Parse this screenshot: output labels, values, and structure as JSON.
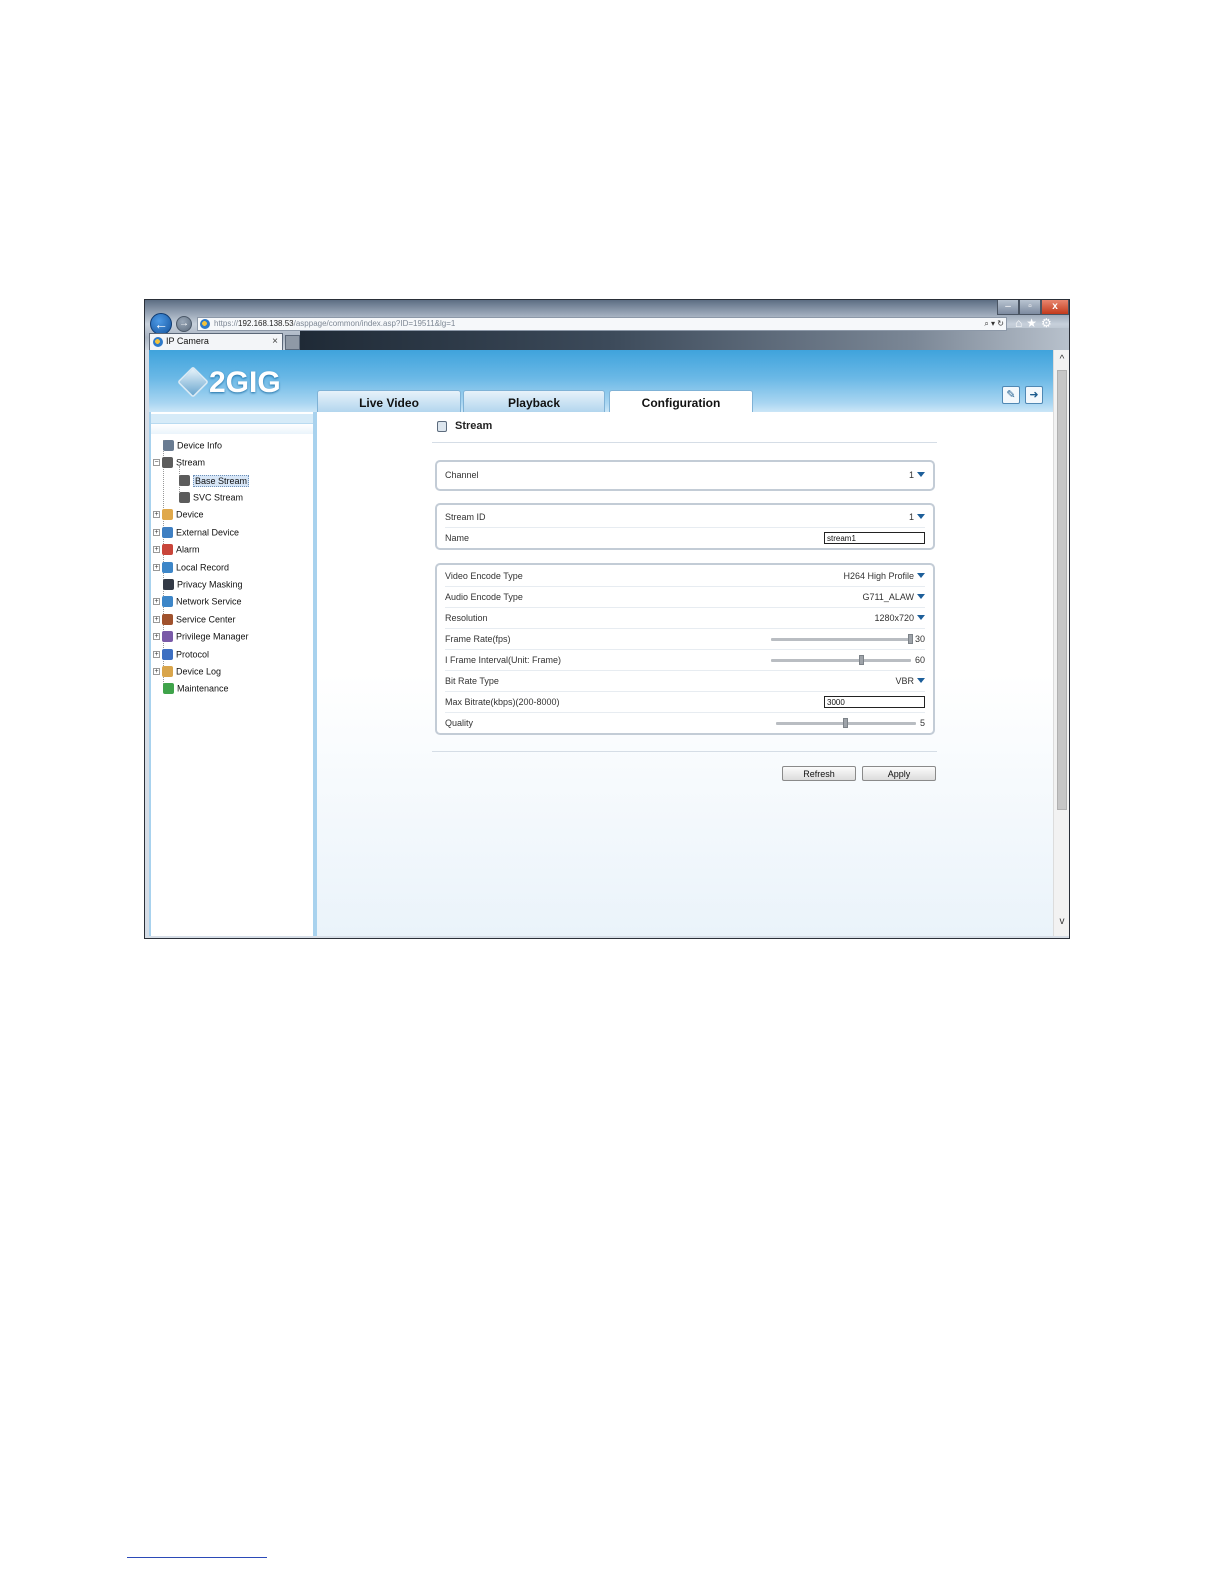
{
  "browser": {
    "window_controls": {
      "minimize": "–",
      "maximize": "▫",
      "close": "x"
    },
    "back": "←",
    "forward": "→",
    "address": {
      "scheme": "https://",
      "host": "192.168.138.53",
      "path": "/asppage/common/index.asp?ID=19511&lg=1",
      "tools": "⌕ ▾ ↻"
    },
    "nav_icons": "⌂★⚙",
    "tab": {
      "title": "IP Camera",
      "close": "×"
    }
  },
  "header": {
    "logo_text": "2GIG",
    "tabs": [
      {
        "label": "Live Video"
      },
      {
        "label": "Playback"
      },
      {
        "label": "Configuration"
      }
    ],
    "active_tab": "Configuration",
    "edit_icon": "✎",
    "logout_icon": "➜"
  },
  "sidebar": {
    "items": [
      {
        "label": "Device Info",
        "icon": "device-info-icon",
        "expander": ""
      },
      {
        "label": "Stream",
        "icon": "stream-icon",
        "expander": "−"
      },
      {
        "label": "Base Stream",
        "icon": "base-stream-icon",
        "expander": "",
        "selected": true
      },
      {
        "label": "SVC Stream",
        "icon": "svc-stream-icon",
        "expander": ""
      },
      {
        "label": "Device",
        "icon": "device-icon",
        "expander": "+"
      },
      {
        "label": "External Device",
        "icon": "external-device-icon",
        "expander": "+"
      },
      {
        "label": "Alarm",
        "icon": "alarm-icon",
        "expander": "+"
      },
      {
        "label": "Local Record",
        "icon": "local-record-icon",
        "expander": "+"
      },
      {
        "label": "Privacy Masking",
        "icon": "privacy-masking-icon",
        "expander": ""
      },
      {
        "label": "Network Service",
        "icon": "network-service-icon",
        "expander": "+"
      },
      {
        "label": "Service Center",
        "icon": "service-center-icon",
        "expander": "+"
      },
      {
        "label": "Privilege Manager",
        "icon": "privilege-manager-icon",
        "expander": "+"
      },
      {
        "label": "Protocol",
        "icon": "protocol-icon",
        "expander": "+"
      },
      {
        "label": "Device Log",
        "icon": "device-log-icon",
        "expander": "+"
      },
      {
        "label": "Maintenance",
        "icon": "maintenance-icon",
        "expander": ""
      }
    ]
  },
  "content": {
    "title": "Stream",
    "channel": {
      "label": "Channel",
      "value": "1"
    },
    "stream_id": {
      "label": "Stream ID",
      "value": "1"
    },
    "name": {
      "label": "Name",
      "value": "stream1"
    },
    "video_encode_type": {
      "label": "Video Encode Type",
      "value": "H264 High Profile"
    },
    "audio_encode_type": {
      "label": "Audio Encode Type",
      "value": "G711_ALAW"
    },
    "resolution": {
      "label": "Resolution",
      "value": "1280x720"
    },
    "frame_rate": {
      "label": "Frame Rate(fps)",
      "value": "30",
      "level": 1.0
    },
    "i_frame_interval": {
      "label": "I Frame Interval(Unit: Frame)",
      "value": "60",
      "level": 0.65
    },
    "bit_rate_type": {
      "label": "Bit Rate Type",
      "value": "VBR"
    },
    "max_bitrate": {
      "label": "Max Bitrate(kbps)(200-8000)",
      "value": "3000"
    },
    "quality": {
      "label": "Quality",
      "value": "5",
      "level": 0.5
    },
    "refresh_label": "Refresh",
    "apply_label": "Apply"
  },
  "scrollbar": {
    "up": "^",
    "down": "v"
  },
  "colors": {
    "header_blue": "#3fa3dc",
    "caret_blue": "#1d5f9a",
    "selected_bg": "#d7e6f7"
  }
}
